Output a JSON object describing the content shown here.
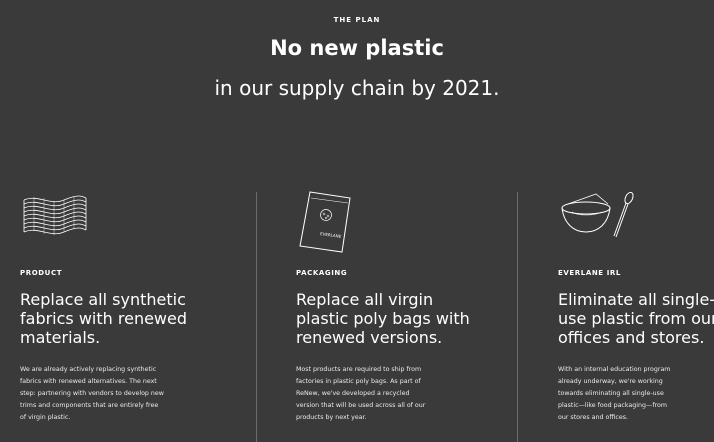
{
  "hero": {
    "eyebrow": "THE PLAN",
    "headline": "No new plastic",
    "subhead": "in our supply chain by 2021."
  },
  "columns": [
    {
      "icon": "fabric-flag-icon",
      "label": "PRODUCT",
      "title_lines": [
        "Replace all synthetic",
        "fabrics with renewed",
        "materials."
      ],
      "body_lines": [
        "We are already actively replacing synthetic",
        "fabrics with renewed alternatives. The next",
        "step: partnering with vendors to develop new",
        "trims and components that are entirely free",
        "of virgin plastic."
      ]
    },
    {
      "icon": "poly-bag-icon",
      "icon_text": "EVERLANE",
      "label": "PACKAGING",
      "title_lines": [
        "Replace all virgin",
        "plastic poly bags with",
        "renewed versions."
      ],
      "body_lines": [
        "Most products are required to ship from",
        "factories in plastic poly bags. As part of",
        "ReNew, we've developed a recycled",
        "version that will be used across all of our",
        "products by next year."
      ]
    },
    {
      "icon": "cup-and-spoon-icon",
      "label": "EVERLANE IRL",
      "title_lines": [
        "Eliminate all single-",
        "use plastic from our",
        "offices and stores."
      ],
      "body_lines": [
        "With an internal education program",
        "already underway, we're working",
        "towards eliminating all single-use",
        "plastic—like food packaging—from",
        "our stores and offices."
      ]
    }
  ],
  "colors": {
    "background": "#3a3a3a",
    "text": "#ffffff",
    "divider": "#6b6b6b"
  }
}
